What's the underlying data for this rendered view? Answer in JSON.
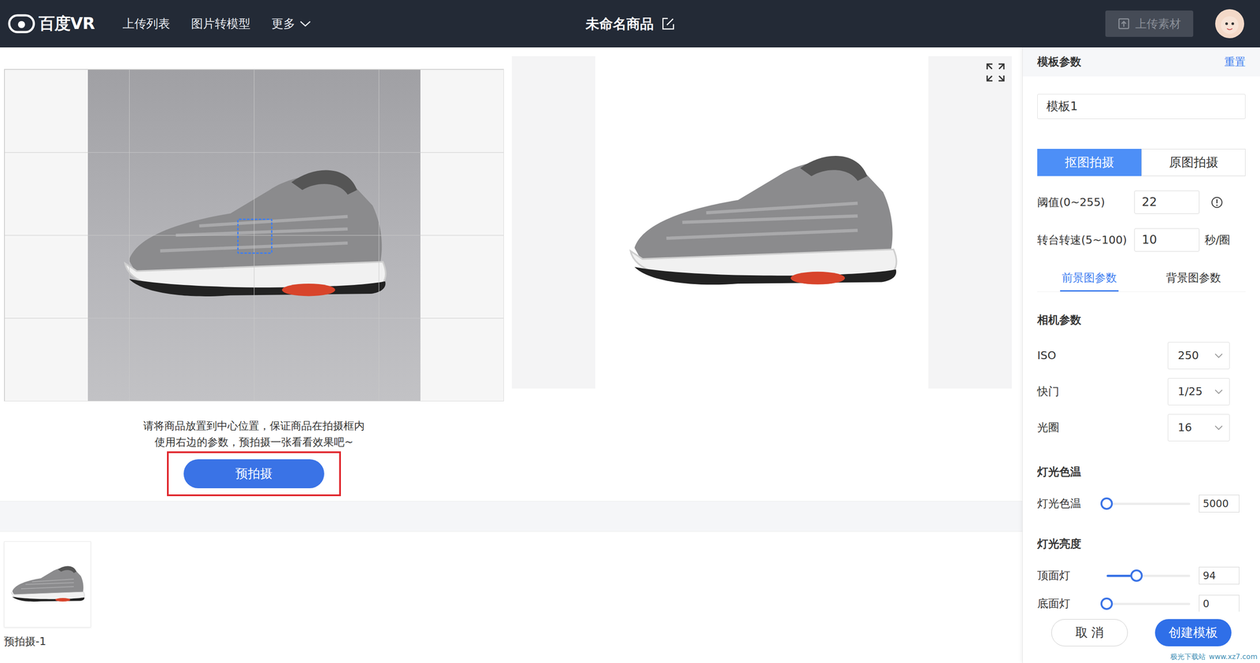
{
  "nav": {
    "logo": "百度VR",
    "menu": [
      {
        "label": "上传列表",
        "kind": "link"
      },
      {
        "label": "图片转模型",
        "kind": "link"
      },
      {
        "label": "更多",
        "kind": "dropdown"
      }
    ],
    "title": "未命名商品",
    "upload": {
      "label": "上传素材",
      "disabled": true
    }
  },
  "capture": {
    "hints": [
      "请将商品放置到中心位置，保证商品在拍摄框内",
      "使用右边的参数，预拍摄一张看看效果吧~"
    ],
    "button": {
      "label": "预拍摄",
      "highlighted": true
    }
  },
  "thumbnails": [
    {
      "label": "预拍摄-1"
    }
  ],
  "panel": {
    "title": "模板参数",
    "reset": "重置",
    "template_name": "模板1",
    "modes": [
      {
        "label": "抠图拍摄",
        "selected": true
      },
      {
        "label": "原图拍摄",
        "selected": false
      }
    ],
    "fields": [
      {
        "label": "阈值(0~255)",
        "value": "22",
        "kind": "info"
      },
      {
        "label": "转台转速(5~100)",
        "value": "10",
        "kind": "unit",
        "unit": "秒/圈"
      }
    ],
    "tabs": [
      {
        "label": "前景图参数",
        "selected": true
      },
      {
        "label": "背景图参数",
        "selected": false
      }
    ],
    "sections": [
      {
        "title": "相机参数",
        "rows": [
          {
            "kind": "select",
            "label": "ISO",
            "value": "250"
          },
          {
            "kind": "select",
            "label": "快门",
            "value": "1/25"
          },
          {
            "kind": "select",
            "label": "光圈",
            "value": "16"
          }
        ]
      },
      {
        "title": "灯光色温",
        "rows": [
          {
            "kind": "slider",
            "label": "灯光色温",
            "level": 0,
            "value": "5000"
          }
        ]
      },
      {
        "title": "灯光亮度",
        "rows": [
          {
            "kind": "slider",
            "label": "顶面灯",
            "level": 0.36,
            "value": "94"
          },
          {
            "kind": "slider",
            "label": "底面灯",
            "level": 0,
            "value": "0"
          }
        ]
      }
    ]
  },
  "footer": {
    "cancel": "取 消",
    "create": "创建模板"
  },
  "watermark": [
    "极光下载站",
    "www.xz7.com"
  ]
}
